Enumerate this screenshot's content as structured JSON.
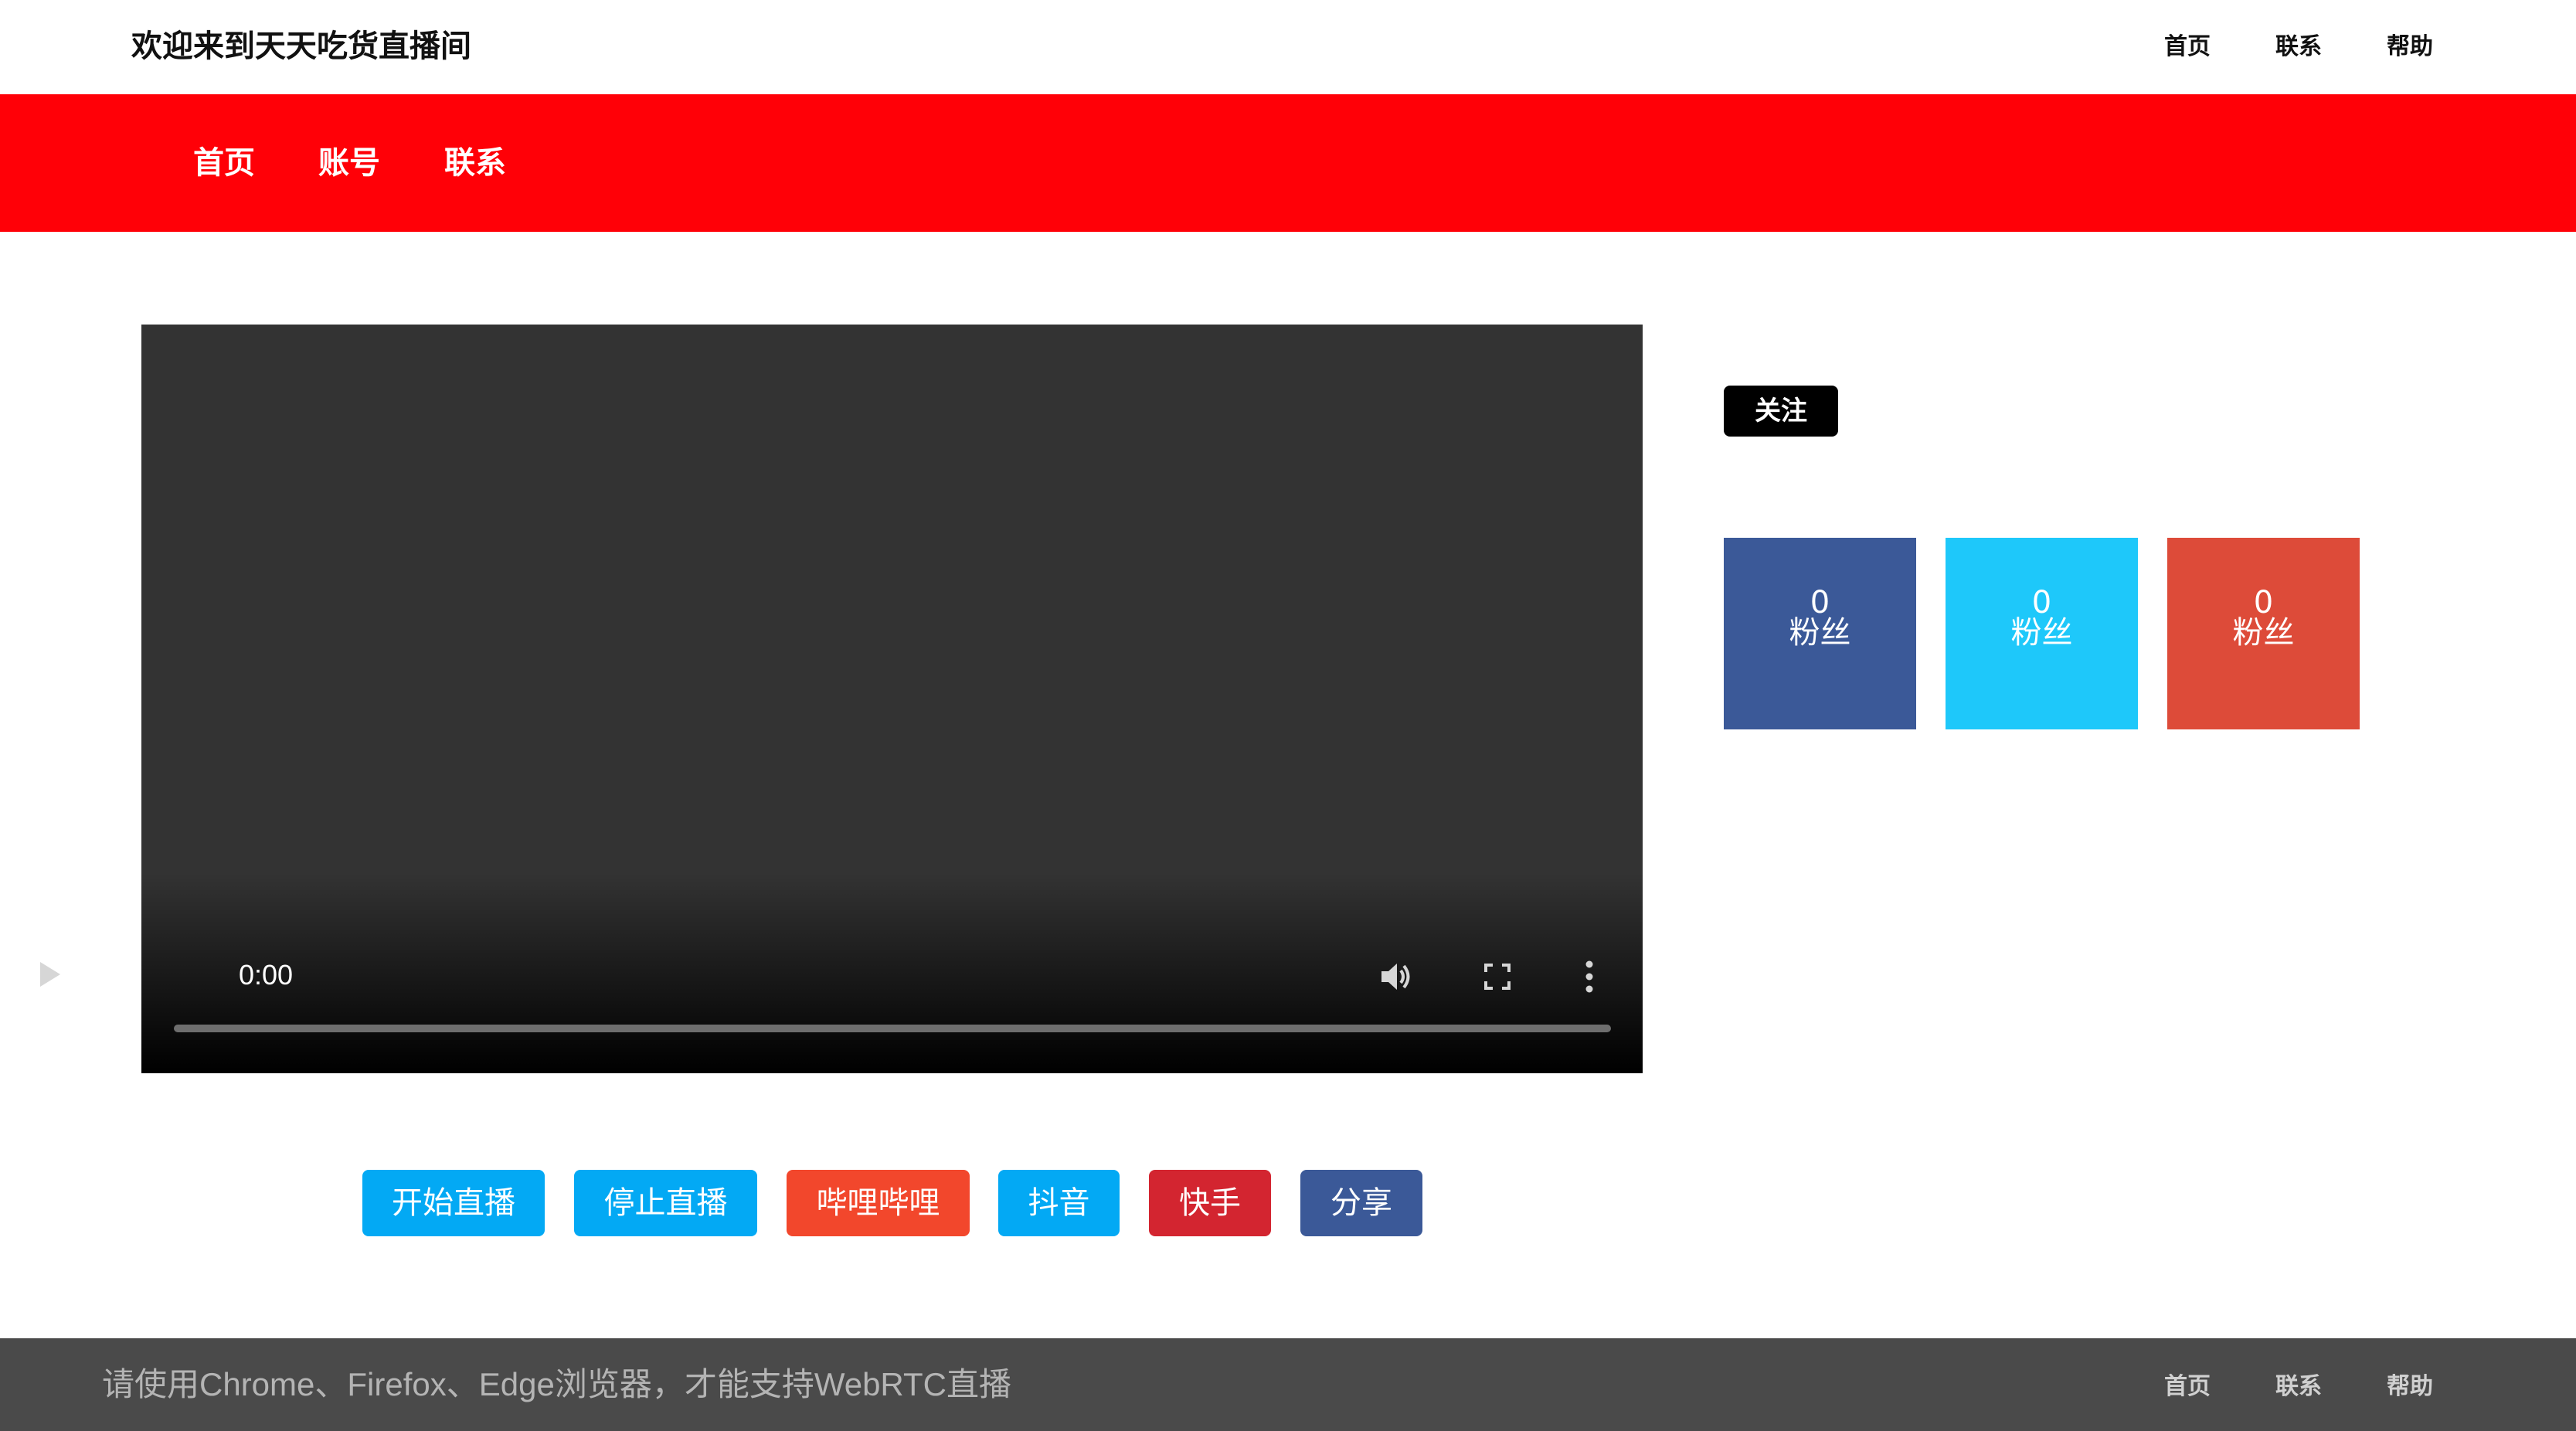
{
  "header": {
    "site_title": "欢迎来到天天吃货直播间",
    "links": [
      "首页",
      "联系",
      "帮助"
    ]
  },
  "nav": {
    "items": [
      "首页",
      "账号",
      "联系"
    ],
    "background": "#ff0007"
  },
  "video": {
    "time": "0:00",
    "icons": [
      "play-icon",
      "volume-icon",
      "fullscreen-icon",
      "more-options-icon"
    ]
  },
  "sidebar": {
    "follow_label": "关注",
    "stats": [
      {
        "count": "0",
        "label": "粉丝",
        "color": "#3b5998"
      },
      {
        "count": "0",
        "label": "粉丝",
        "color": "#1ec8fa"
      },
      {
        "count": "0",
        "label": "粉丝",
        "color": "#dd4b39"
      }
    ]
  },
  "actions": [
    {
      "label": "开始直播",
      "color": "#03a9f4"
    },
    {
      "label": "停止直播",
      "color": "#03a9f4"
    },
    {
      "label": "哔哩哔哩",
      "color": "#f2472c"
    },
    {
      "label": "抖音",
      "color": "#03a9f4"
    },
    {
      "label": "快手",
      "color": "#d32530"
    },
    {
      "label": "分享",
      "color": "#3b5998"
    }
  ],
  "footer": {
    "text": "请使用Chrome、Firefox、Edge浏览器，才能支持WebRTC直播",
    "links": [
      "首页",
      "联系",
      "帮助"
    ]
  }
}
